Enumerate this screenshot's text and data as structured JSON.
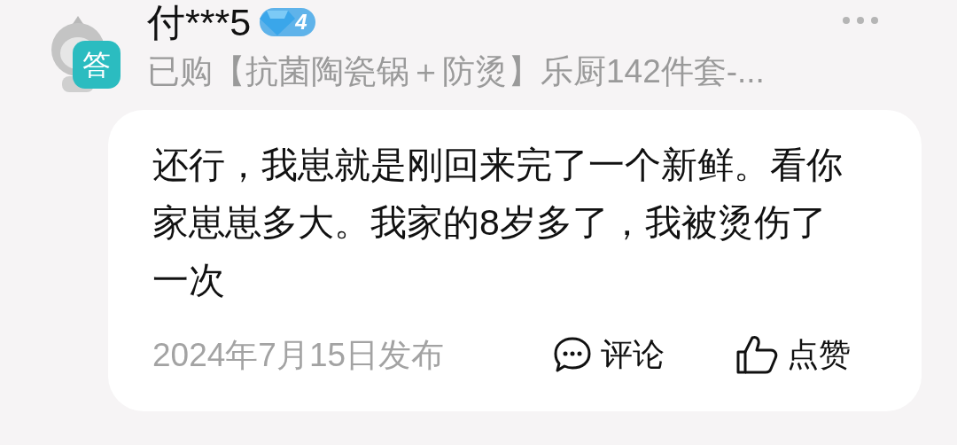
{
  "user": {
    "name": "付***5",
    "level": "4",
    "badge_text": "答",
    "purchase": "已购【抗菌陶瓷锅＋防烫】乐厨142件套-..."
  },
  "answer": {
    "text": "还行，我崽就是刚回来完了一个新鲜。看你家崽崽多大。我家的8岁多了，我被烫伤了一次",
    "date": "2024年7月15日发布"
  },
  "actions": [
    {
      "kind": "comment",
      "label": "评论"
    },
    {
      "kind": "like",
      "label": "点赞"
    }
  ]
}
